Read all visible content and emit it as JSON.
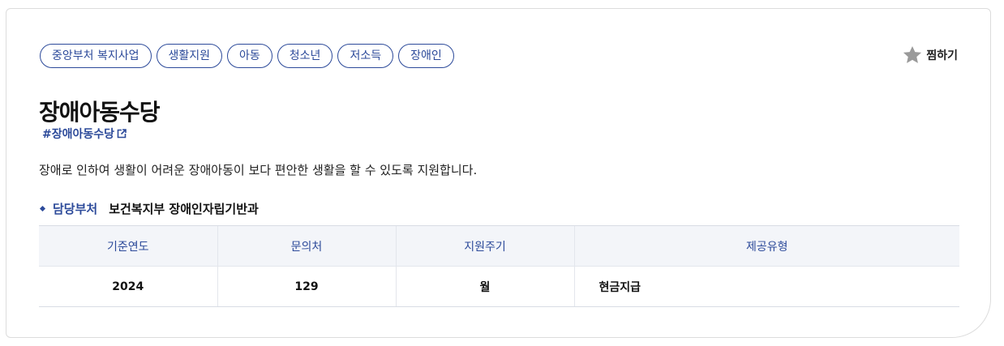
{
  "tags": [
    "중앙부처 복지사업",
    "생활지원",
    "아동",
    "청소년",
    "저소득",
    "장애인"
  ],
  "favorite": {
    "label": "찜하기",
    "icon": "star-icon"
  },
  "title": "장애아동수당",
  "hashtag": {
    "text": "#장애아동수당",
    "icon": "external-link-icon"
  },
  "description": "장애로 인하여 생활이 어려운 장애아동이 보다 편안한 생활을 할 수 있도록 지원합니다.",
  "department": {
    "label": "담당부처",
    "value": "보건복지부 장애인자립기반과"
  },
  "table": {
    "headers": [
      "기준연도",
      "문의처",
      "지원주기",
      "제공유형"
    ],
    "rows": [
      [
        "2024",
        "129",
        "월",
        "현금지급"
      ]
    ]
  },
  "colors": {
    "accent": "#2c4a9a",
    "star": "#9a9a9a",
    "header_bg": "#f3f5f9"
  }
}
